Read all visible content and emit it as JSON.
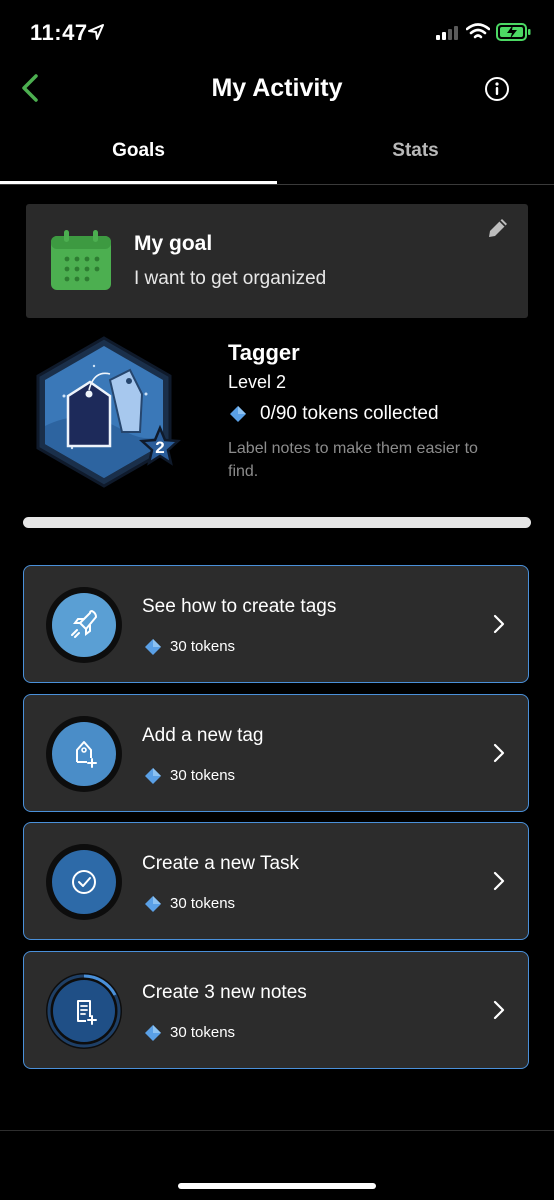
{
  "status_bar": {
    "time": "11:47"
  },
  "header": {
    "title": "My Activity"
  },
  "tabs": [
    {
      "label": "Goals"
    },
    {
      "label": "Stats"
    }
  ],
  "goal": {
    "label": "My goal",
    "text": "I want to get organized"
  },
  "badge": {
    "title": "Tagger",
    "level": "Level 2",
    "level_number": "2",
    "tokens": "0/90 tokens collected",
    "description": "Label notes to make them easier to find."
  },
  "progress": {
    "fraction": 0.0
  },
  "tasks": [
    {
      "title": "See how to create tags",
      "tokens": "30 tokens",
      "icon": "rocket-icon"
    },
    {
      "title": "Add a new tag",
      "tokens": "30 tokens",
      "icon": "tag-plus-icon"
    },
    {
      "title": "Create a new Task",
      "tokens": "30 tokens",
      "icon": "checkmark-circle-icon"
    },
    {
      "title": "Create 3 new notes",
      "tokens": "30 tokens",
      "icon": "note-plus-icon"
    }
  ],
  "colors": {
    "accent_green": "#4caf50",
    "accent_blue": "#4a90d9",
    "card_bg": "#2a2a2a"
  }
}
